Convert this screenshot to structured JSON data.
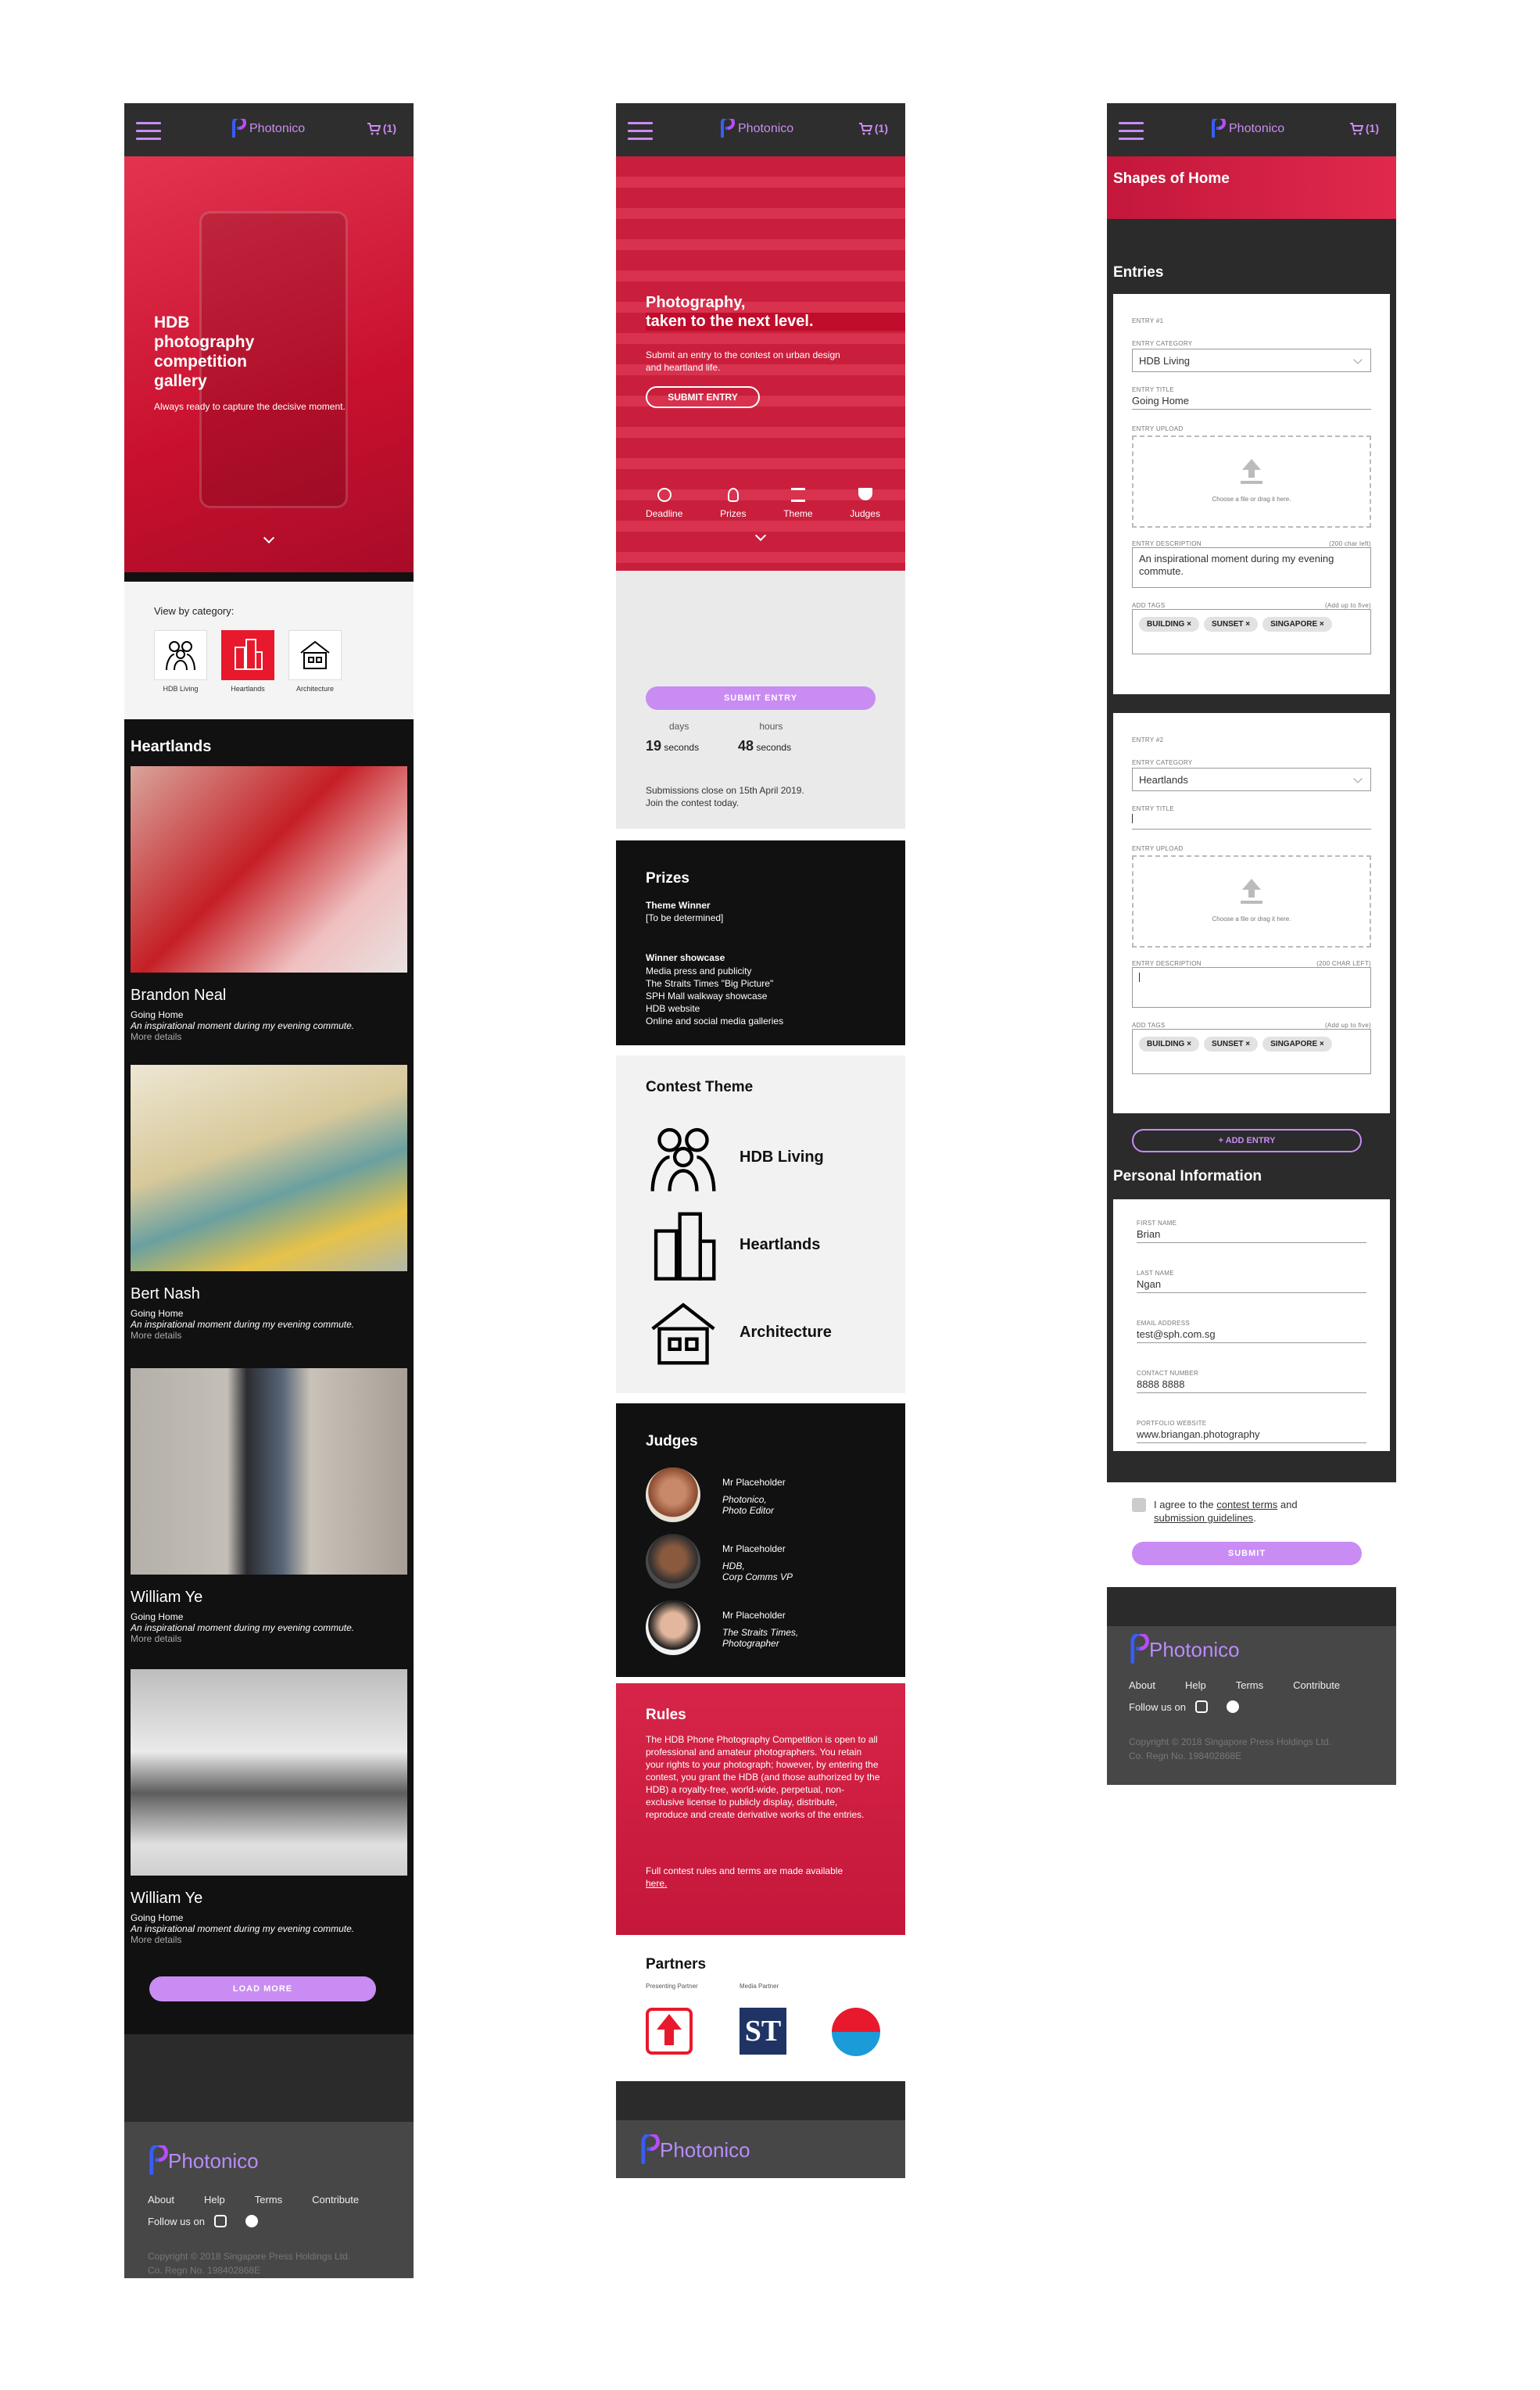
{
  "brand": {
    "name": "Photonico",
    "cart": "(1)"
  },
  "screen1": {
    "hero_title": "HDB photography competition gallery",
    "hero_sub": "Always ready to capture the decisive moment.",
    "view_by": "View by category:",
    "categories": [
      "HDB Living",
      "Heartlands",
      "Architecture"
    ],
    "section_title": "Heartlands",
    "entries": [
      {
        "name": "Brandon Neal",
        "title": "Going Home",
        "desc": "An inspirational moment during my evening commute.",
        "more": "More details"
      },
      {
        "name": "Bert Nash",
        "title": "Going Home",
        "desc": "An inspirational moment during my evening commute.",
        "more": "More details"
      },
      {
        "name": "William Ye",
        "title": "Going Home",
        "desc": "An inspirational moment during my evening commute.",
        "more": "More details"
      },
      {
        "name": "William Ye",
        "title": "Going Home",
        "desc": "An inspirational moment during my evening commute.",
        "more": "More details"
      }
    ],
    "load_more": "LOAD MORE"
  },
  "screen2": {
    "hero_title_1": "Photography,",
    "hero_title_2": "taken to the next level.",
    "hero_sub": "Submit an entry to the contest on urban design and heartland life.",
    "submit_outline": "SUBMIT ENTRY",
    "nav": [
      "Deadline",
      "Prizes",
      "Theme",
      "Judges"
    ],
    "submit_entry": "SUBMIT ENTRY",
    "countdown": [
      {
        "num": "19",
        "unit": "seconds"
      },
      {
        "num": "48",
        "unit": "seconds"
      }
    ],
    "countdown_partial": [
      "days",
      "hours"
    ],
    "close_note": "Submissions close on 15th April 2019.",
    "join_note": "Join the contest today.",
    "prizes_title": "Prizes",
    "prize_winner_label": "Theme Winner",
    "prize_winner_val": "[To be determined]",
    "showcase_label": "Winner showcase",
    "showcase_items": [
      "Media press and publicity",
      "The Straits Times \"Big Picture\"",
      "SPH Mall walkway showcase",
      "HDB website",
      "Online and social media galleries"
    ],
    "theme_title": "Contest Theme",
    "themes": [
      "HDB Living",
      "Heartlands",
      "Architecture"
    ],
    "judges_title": "Judges",
    "judges": [
      {
        "name": "Mr Placeholder",
        "org": "Photonico,",
        "role": "Photo Editor"
      },
      {
        "name": "Mr Placeholder",
        "org": "HDB,",
        "role": "Corp Comms VP"
      },
      {
        "name": "Mr Placeholder",
        "org": "The Straits Times,",
        "role": "Photographer"
      }
    ],
    "rules_title": "Rules",
    "rules_body": "The HDB  Phone Photography Competition is open to all professional and amateur photographers. You retain your rights to your photograph; however, by entering the contest, you grant the HDB (and those authorized by the HDB) a royalty-free, world-wide, perpetual, non-exclusive license to publicly display, distribute, reproduce and create derivative works of the entries.",
    "rules_more": "Full contest rules and terms are made available",
    "rules_link": "here.",
    "partners_title": "Partners",
    "presenting": "Presenting Partner",
    "media": "Media Partner"
  },
  "screen3": {
    "banner": "Shapes of Home",
    "entries_title": "Entries",
    "entry1": {
      "heading": "ENTRY #1",
      "cat_label": "ENTRY CATEGORY",
      "cat": "HDB Living",
      "title_label": "ENTRY TITLE",
      "title": "Going Home",
      "upload_label": "ENTRY UPLOAD",
      "upload_text": "Choose a file or drag it here.",
      "desc_label": "ENTRY DESCRIPTION",
      "desc_left": "(200 char left)",
      "desc": "An inspirational moment during my evening commute.",
      "tags_label": "ADD TAGS",
      "tags_hint": "(Add up to five)"
    },
    "entry2": {
      "heading": "ENTRY #2",
      "cat_label": "ENTRY CATEGORY",
      "cat": "Heartlands",
      "title_label": "ENTRY TITLE",
      "upload_label": "ENTRY UPLOAD",
      "upload_text": "Choose a file or drag it here.",
      "desc_label": "ENTRY DESCRIPTION",
      "desc_left": "(200 CHAR LEFT)",
      "tags_label": "ADD TAGS",
      "tags_hint": "(Add up to five)"
    },
    "tags": [
      "BUILDING ×",
      "SUNSET ×",
      "SINGAPORE ×"
    ],
    "add_entry": "+ ADD ENTRY",
    "personal_title": "Personal Information",
    "fields": [
      {
        "label": "FIRST NAME",
        "value": "Brian"
      },
      {
        "label": "LAST NAME",
        "value": "Ngan"
      },
      {
        "label": "EMAIL ADDRESS",
        "value": "test@sph.com.sg"
      },
      {
        "label": "CONTACT NUMBER",
        "value": "8888 8888"
      },
      {
        "label": "PORTFOLIO WEBSITE",
        "value": "www.briangan.photography"
      }
    ],
    "agree_1": "I agree to the",
    "agree_terms": "contest terms",
    "agree_and": "and",
    "agree_guidelines": "submission guidelines",
    "agree_end": ".",
    "submit": "SUBMIT"
  },
  "footer": {
    "links": [
      "About",
      "Help",
      "Terms",
      "Contribute"
    ],
    "follow": "Follow us on",
    "copy1": "Copyright © 2018 Singapore Press Holdings Ltd.",
    "copy2": "Co. Regn No. 198402868E"
  },
  "colors": {
    "accent": "#c98cf3",
    "red": "#d9163a",
    "dark": "#2e2e2e",
    "black": "#0d0d0d"
  }
}
